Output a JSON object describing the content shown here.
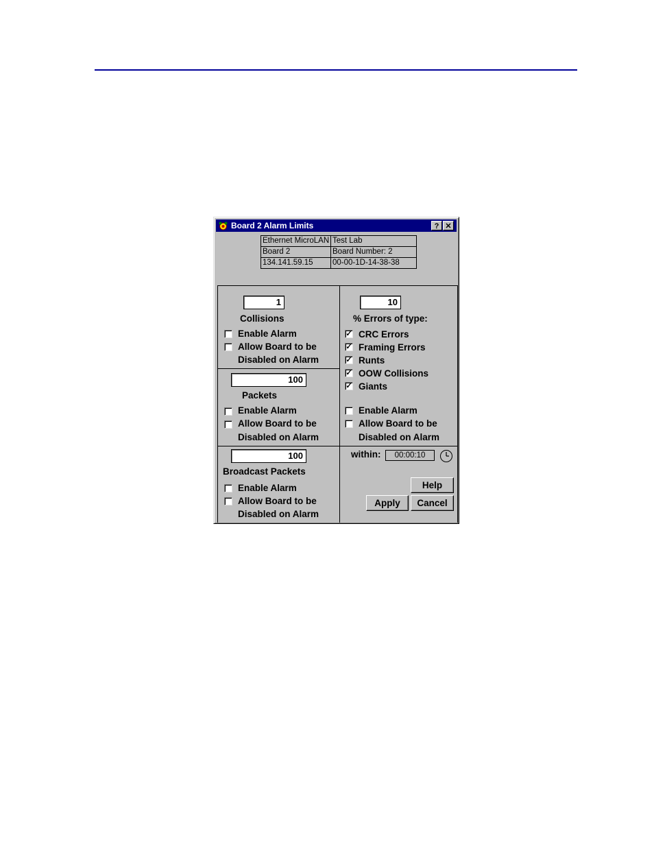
{
  "window": {
    "title": "Board 2 Alarm Limits",
    "icon": "alarm-clock-icon",
    "help_btn": "?",
    "close_btn": "✕"
  },
  "info_table": [
    [
      "Ethernet MicroLAN",
      "Test Lab"
    ],
    [
      "Board 2",
      "Board Number:  2"
    ],
    [
      "134.141.59.15",
      "00-00-1D-14-38-38"
    ]
  ],
  "collisions": {
    "value": "1",
    "label": "Collisions",
    "enable_alarm": {
      "label": "Enable Alarm",
      "checked": false
    },
    "allow_disable": {
      "label1": "Allow Board to be",
      "label2": "Disabled on Alarm",
      "checked": false
    }
  },
  "packets": {
    "value": "100",
    "label": "Packets",
    "enable_alarm": {
      "label": "Enable Alarm",
      "checked": false
    },
    "allow_disable": {
      "label1": "Allow Board to be",
      "label2": "Disabled on Alarm",
      "checked": false
    }
  },
  "broadcast": {
    "value": "100",
    "label": "Broadcast Packets",
    "enable_alarm": {
      "label": "Enable Alarm",
      "checked": false
    },
    "allow_disable": {
      "label1": "Allow Board to be",
      "label2": "Disabled on Alarm",
      "checked": false
    }
  },
  "errors": {
    "value": "10",
    "label": "% Errors of type:",
    "types": [
      {
        "label": "CRC Errors",
        "checked": true
      },
      {
        "label": "Framing Errors",
        "checked": true
      },
      {
        "label": "Runts",
        "checked": true
      },
      {
        "label": "OOW Collisions",
        "checked": true
      },
      {
        "label": "Giants",
        "checked": true
      }
    ],
    "enable_alarm": {
      "label": "Enable Alarm",
      "checked": false
    },
    "allow_disable": {
      "label1": "Allow Board to be",
      "label2": "Disabled on Alarm",
      "checked": false
    }
  },
  "within": {
    "label": "within:",
    "value": "00:00:10",
    "icon": "clock-icon"
  },
  "buttons": {
    "help": "Help",
    "apply": "Apply",
    "cancel": "Cancel"
  },
  "checkmark": "✓",
  "colors": {
    "titlebar": "#000080",
    "dialog_bg": "#c0c0c0",
    "page_rule": "#000099"
  }
}
